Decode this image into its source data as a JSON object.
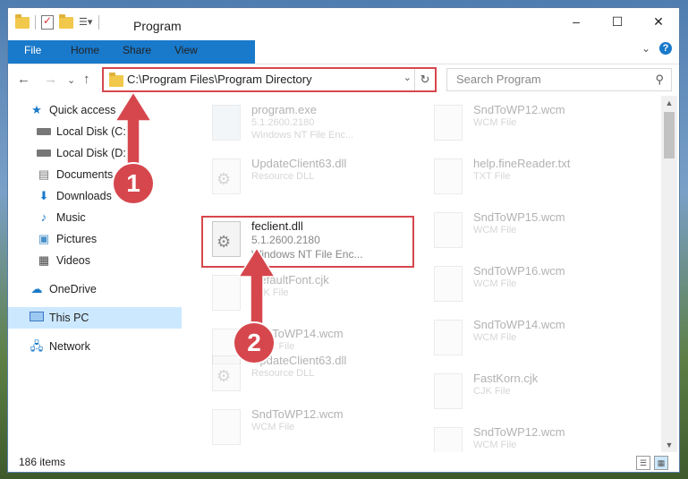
{
  "window": {
    "title": "Program"
  },
  "window_controls": {
    "minimize": "–",
    "maximize": "☐",
    "close": "✕"
  },
  "ribbon": {
    "tabs": [
      "File",
      "Home",
      "Share",
      "View"
    ],
    "expand": "⌄",
    "help": "?"
  },
  "nav": {
    "back": "←",
    "forward": "→",
    "recent": "⌄",
    "up": "↑"
  },
  "address": {
    "path": "C:\\Program Files\\Program Directory",
    "dropdown": "⌄",
    "refresh": "↻"
  },
  "search": {
    "placeholder": "Search Program",
    "icon": "⚲"
  },
  "sidebar": {
    "items": [
      {
        "label": "Quick access",
        "icon": "star-icon"
      },
      {
        "label": "Local Disk (C:)",
        "icon": "drive-icon",
        "pinned": true
      },
      {
        "label": "Local Disk (D:)",
        "icon": "drive-icon",
        "pinned": true
      },
      {
        "label": "Documents",
        "icon": "documents-icon",
        "pinned": true
      },
      {
        "label": "Downloads",
        "icon": "download-icon",
        "pinned": true
      },
      {
        "label": "Music",
        "icon": "music-icon",
        "pinned": true
      },
      {
        "label": "Pictures",
        "icon": "pictures-icon",
        "pinned": true
      },
      {
        "label": "Videos",
        "icon": "videos-icon",
        "pinned": true
      },
      {
        "label": "OneDrive",
        "icon": "cloud-icon"
      },
      {
        "label": "This PC",
        "icon": "pc-icon",
        "selected": true
      },
      {
        "label": "Network",
        "icon": "network-icon"
      }
    ]
  },
  "files": {
    "left": [
      {
        "name": "program.exe",
        "line1": "5.1.2600.2180",
        "line2": "Windows NT File Enc..."
      },
      {
        "name": "UpdateClient63.dll",
        "line1": "Resource DLL",
        "line2": ""
      },
      {
        "name": "feclient.dll",
        "line1": "5.1.2600.2180",
        "line2": "Windows NT File Enc..."
      },
      {
        "name": "DefaultFont.cjk",
        "line1": "CJK File",
        "line2": ""
      },
      {
        "name": "SndToWP14.wcm",
        "line1": "WCM File",
        "line2": ""
      },
      {
        "name": "UpdateClient63.dll",
        "line1": "Resource DLL",
        "line2": ""
      },
      {
        "name": "SndToWP12.wcm",
        "line1": "WCM File",
        "line2": ""
      }
    ],
    "right": [
      {
        "name": "SndToWP12.wcm",
        "line1": "WCM File"
      },
      {
        "name": "help.fineReader.txt",
        "line1": "TXT File"
      },
      {
        "name": "SndToWP15.wcm",
        "line1": "WCM File"
      },
      {
        "name": "SndToWP16.wcm",
        "line1": "WCM File"
      },
      {
        "name": "SndToWP14.wcm",
        "line1": "WCM File"
      },
      {
        "name": "FastKorn.cjk",
        "line1": "CJK File"
      },
      {
        "name": "SndToWP12.wcm",
        "line1": "WCM File"
      }
    ]
  },
  "status": {
    "items": "186 items"
  },
  "callouts": {
    "step1": "1",
    "step2": "2"
  },
  "colors": {
    "accent": "#1979ca",
    "highlight": "#d6474d",
    "selected_bg": "#cce8ff"
  }
}
